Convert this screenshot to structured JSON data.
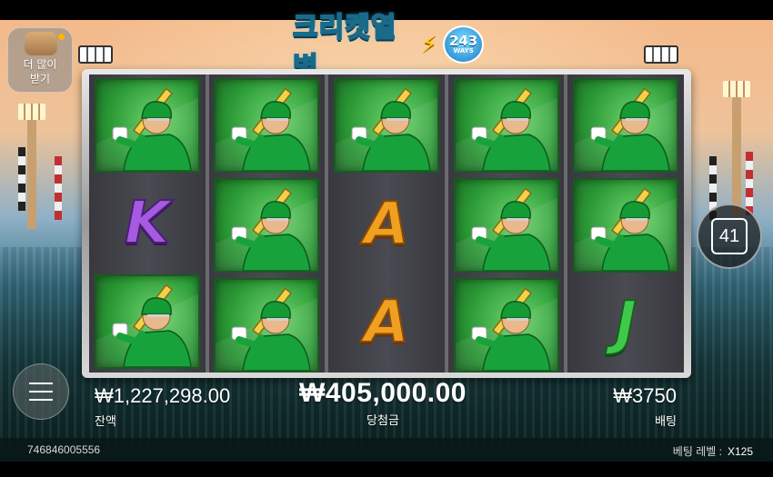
{
  "game": {
    "logo_text": "크리켓열병",
    "logo_ways_number": "243",
    "logo_ways_label": "WAYS"
  },
  "more_games_button": {
    "label_line1": "더 많이",
    "label_line2": "받기"
  },
  "reels": [
    [
      "batsman",
      "K",
      "batsman"
    ],
    [
      "batsman",
      "batsman",
      "batsman"
    ],
    [
      "batsman",
      "A",
      "A"
    ],
    [
      "batsman",
      "batsman",
      "batsman"
    ],
    [
      "batsman",
      "batsman",
      "J"
    ]
  ],
  "symbols": {
    "batsman": {
      "icon": "cricket-batsman-icon"
    },
    "K": {
      "text": "K",
      "color": "#a55ae0"
    },
    "A": {
      "text": "A",
      "color": "#f0a021"
    },
    "J": {
      "text": "J",
      "color": "#3fc84a"
    }
  },
  "free_spin_counter": "41",
  "balance": {
    "value": "₩1,227,298.00",
    "label": "잔액"
  },
  "win": {
    "value": "₩405,000.00",
    "label": "당첨금"
  },
  "bet": {
    "value": "₩3750",
    "label": "배팅"
  },
  "session_id": "746846005556",
  "bet_level": {
    "label": "베팅 레벨 :",
    "value": "X125"
  },
  "menu_icon": "hamburger-menu-icon"
}
